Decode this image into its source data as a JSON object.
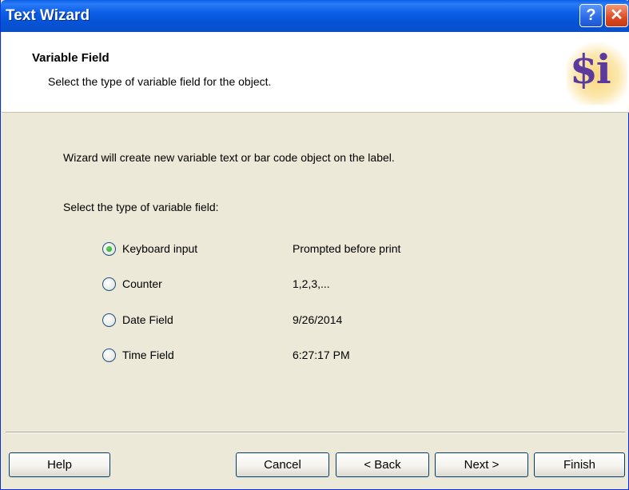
{
  "window": {
    "title": "Text Wizard",
    "help_glyph": "?",
    "close_glyph": "✕"
  },
  "header": {
    "title": "Variable Field",
    "subtitle": "Select the type of variable field for the object.",
    "logo_text": "$i"
  },
  "content": {
    "intro": "Wizard will create new variable text or bar code object on the label.",
    "select_label": "Select the type of variable field:",
    "options": [
      {
        "label": "Keyboard input",
        "value": "Prompted before print",
        "selected": true
      },
      {
        "label": "Counter",
        "value": "1,2,3,...",
        "selected": false
      },
      {
        "label": "Date Field",
        "value": "9/26/2014",
        "selected": false
      },
      {
        "label": "Time Field",
        "value": "6:27:17 PM",
        "selected": false
      }
    ]
  },
  "buttons": {
    "help": "Help",
    "cancel": "Cancel",
    "back": "< Back",
    "next": "Next >",
    "finish": "Finish"
  },
  "colors": {
    "titlebar": "#0553d6",
    "dialog_bg": "#ece9d8",
    "header_bg": "#ffffff",
    "radio_check": "#21a121"
  }
}
